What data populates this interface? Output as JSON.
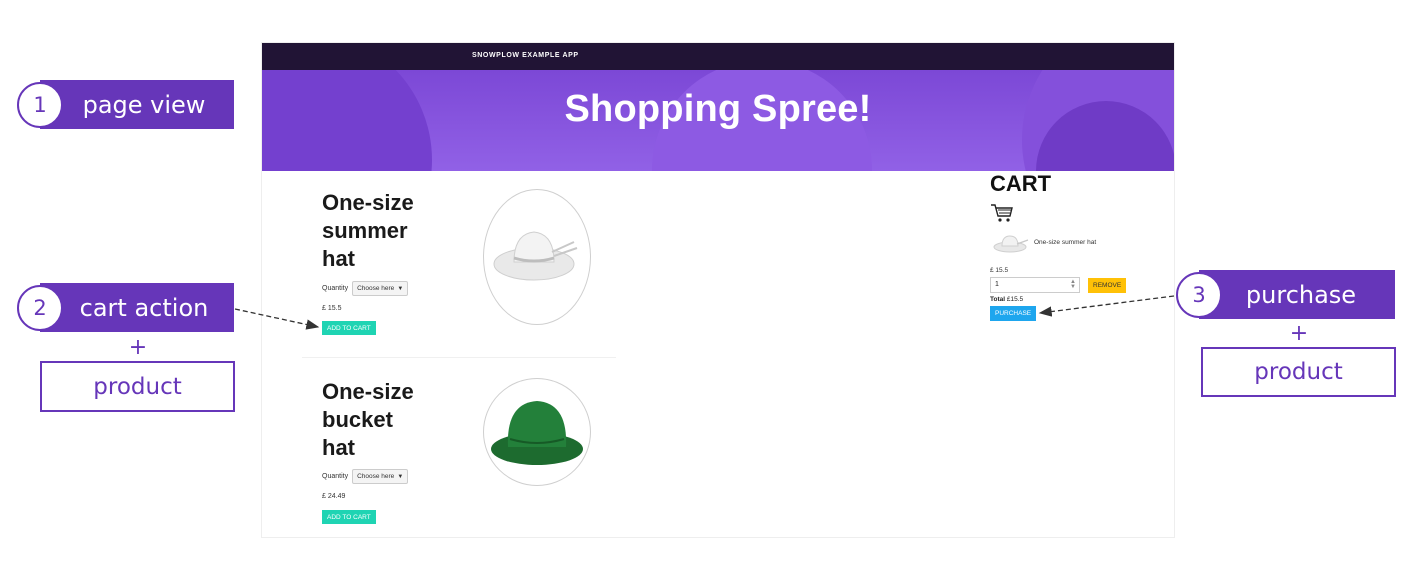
{
  "annotations": {
    "page_view": {
      "number": "1",
      "label": "page view"
    },
    "cart_action": {
      "number": "2",
      "label": "cart action",
      "plus": "+",
      "context": "product"
    },
    "purchase": {
      "number": "3",
      "label": "purchase",
      "plus": "+",
      "context": "product"
    }
  },
  "app": {
    "brand": "SNOWPLOW EXAMPLE APP",
    "hero_title": "Shopping Spree!",
    "quantity_label": "Quantity",
    "select_placeholder": "Choose here",
    "add_to_cart_label": "ADD TO CART",
    "products": [
      {
        "title_lines": [
          "One-size",
          "summer",
          "hat"
        ],
        "price": "£ 15.5",
        "image": "white-sun-hat"
      },
      {
        "title_lines": [
          "One-size",
          "bucket",
          "hat"
        ],
        "price": "£ 24.49",
        "image": "green-bucket-hat"
      }
    ],
    "cart": {
      "title": "CART",
      "icon": "shopping-cart-icon",
      "item_name": "One-size summer hat",
      "item_price": "£ 15.5",
      "quantity_value": "1",
      "remove_label": "REMOVE",
      "total_label": "Total",
      "total_value": "£15.5",
      "purchase_label": "PURCHASE"
    }
  },
  "colors": {
    "brand_purple": "#6636b9",
    "hero_purple": "#8552e0",
    "topbar": "#211435",
    "add_to_cart": "#1fd4b3",
    "remove": "#ffc107",
    "purchase": "#1ea6ee"
  }
}
